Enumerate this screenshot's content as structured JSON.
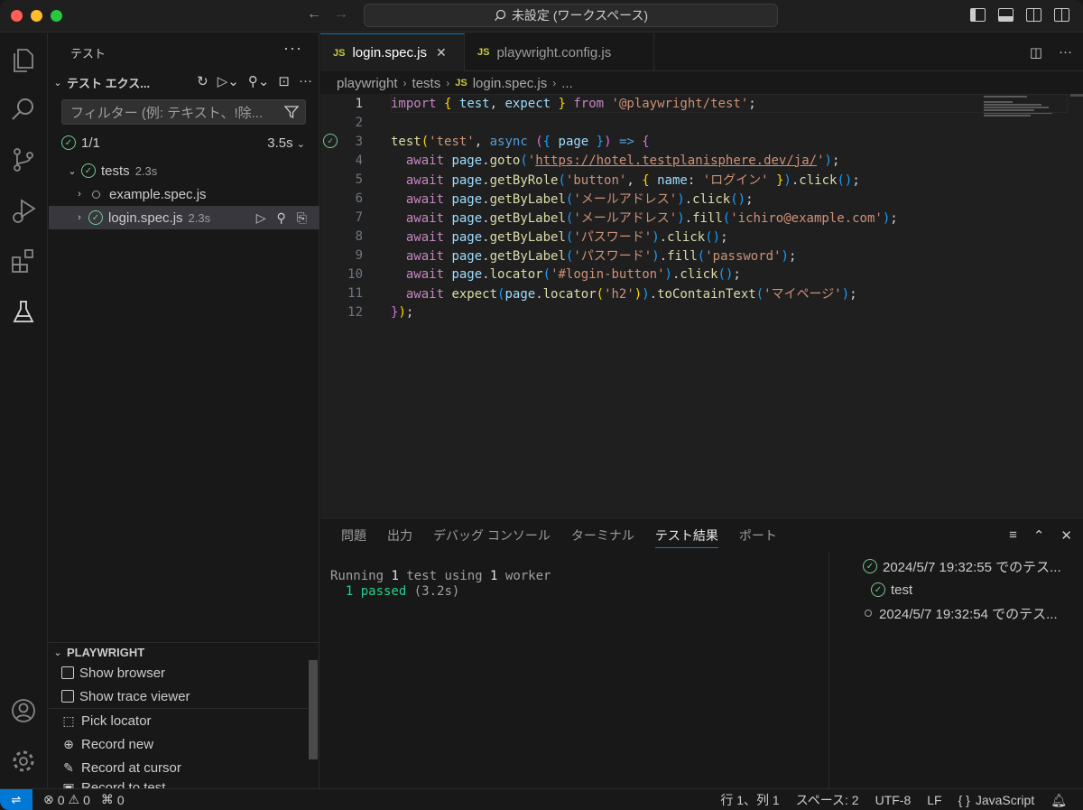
{
  "titlebar": {
    "search_text": "未設定 (ワークスペース)"
  },
  "sidebar": {
    "title": "テスト",
    "more": "···",
    "section_title": "テスト エクス...",
    "filter_placeholder": "フィルター (例: テキスト、!除...",
    "summary_count": "1/1",
    "summary_duration": "3.5s",
    "tree": [
      {
        "label": "tests",
        "sub": "2.3s"
      },
      {
        "label": "example.spec.js",
        "sub": ""
      },
      {
        "label": "login.spec.js",
        "sub": "2.3s"
      }
    ],
    "playwright": {
      "title": "PLAYWRIGHT",
      "items": [
        "Show browser",
        "Show trace viewer",
        "Pick locator",
        "Record new",
        "Record at cursor",
        "Record to test"
      ]
    }
  },
  "editor": {
    "tabs": [
      {
        "icon": "JS",
        "label": "login.spec.js"
      },
      {
        "icon": "JS",
        "label": "playwright.config.js"
      }
    ],
    "breadcrumb": [
      "playwright",
      "tests",
      "login.spec.js",
      "..."
    ],
    "breadcrumb_js": "JS",
    "lines": [
      {
        "n": "1"
      },
      {
        "n": "2"
      },
      {
        "n": "3"
      },
      {
        "n": "4"
      },
      {
        "n": "5"
      },
      {
        "n": "6"
      },
      {
        "n": "7"
      },
      {
        "n": "8"
      },
      {
        "n": "9"
      },
      {
        "n": "10"
      },
      {
        "n": "11"
      },
      {
        "n": "12"
      }
    ],
    "code": {
      "l1_import": "import",
      "l1_test": "test",
      "l1_expect": "expect",
      "l1_from": "from",
      "l1_mod": "'@playwright/test'",
      "l3_test": "test",
      "l3_name": "'test'",
      "l3_async": "async",
      "l3_page": "page",
      "await": "await",
      "page": "page",
      "l4_fn": "goto",
      "l4_url": "https://hotel.testplanisphere.dev/ja/",
      "l5_fn": "getByRole",
      "l5_arg": "'button'",
      "l5_key": "name",
      "l5_val": "'ログイン'",
      "l5_click": "click",
      "l6_fn": "getByLabel",
      "l6_arg": "'メールアドレス'",
      "l6_click": "click",
      "l7_fn": "getByLabel",
      "l7_arg": "'メールアドレス'",
      "l7_fill": "fill",
      "l7_val": "'ichiro@example.com'",
      "l8_fn": "getByLabel",
      "l8_arg": "'パスワード'",
      "l8_click": "click",
      "l9_fn": "getByLabel",
      "l9_arg": "'パスワード'",
      "l9_fill": "fill",
      "l9_val": "'password'",
      "l10_fn": "locator",
      "l10_arg": "'#login-button'",
      "l10_click": "click",
      "l11_expect": "expect",
      "l11_loc": "locator",
      "l11_arg": "'h2'",
      "l11_fn": "toContainText",
      "l11_val": "'マイページ'"
    }
  },
  "panel": {
    "tabs": [
      "問題",
      "出力",
      "デバッグ コンソール",
      "ターミナル",
      "テスト結果",
      "ポート"
    ],
    "terminal": {
      "running": "Running ",
      "n1": "1",
      "mid": " test using ",
      "n2": "1",
      "worker": " worker",
      "passed": "  1 passed",
      "dur": " (3.2s)"
    },
    "results": [
      {
        "label": "2024/5/7 19:32:55 でのテス..."
      },
      {
        "label": "test"
      },
      {
        "label": "2024/5/7 19:32:54 でのテス..."
      }
    ]
  },
  "status": {
    "errors": "0",
    "warnings": "0",
    "ports": "0",
    "position": "行 1、列 1",
    "spaces": "スペース: 2",
    "encoding": "UTF-8",
    "eol": "LF",
    "language_icon": "{ }",
    "language": "JavaScript"
  }
}
